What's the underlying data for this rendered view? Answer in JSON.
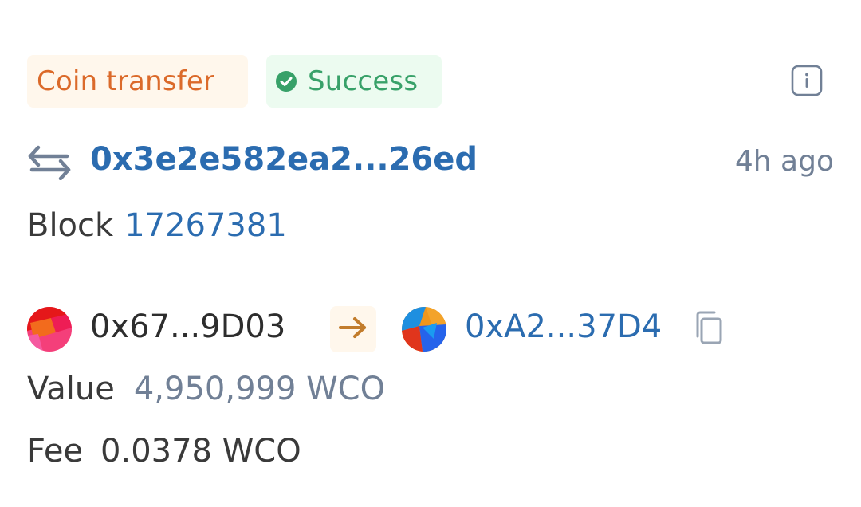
{
  "tags": {
    "type_label": "Coin transfer",
    "status_label": "Success"
  },
  "transaction": {
    "hash": "0x3e2e582ea2...26ed",
    "time_ago": "4h ago"
  },
  "block": {
    "label": "Block",
    "number": "17267381"
  },
  "addresses": {
    "from": "0x67...9D03",
    "to": "0xA2...37D4"
  },
  "value": {
    "label": "Value",
    "amount": "4,950,999 WCO"
  },
  "fee": {
    "label": "Fee",
    "amount": "0.0378 WCO"
  },
  "icons": {
    "status": "check-circle-icon",
    "info": "info-icon",
    "transfer": "swap-arrows-icon",
    "direction": "arrow-right-icon",
    "copy": "copy-icon"
  },
  "colors": {
    "type_tag_text": "#db6a2a",
    "type_tag_bg": "#fff7ec",
    "status_tag_text": "#38a169",
    "status_tag_bg": "#ecfbf0",
    "link": "#2b6cb0",
    "muted": "#718096",
    "text": "#3a3a3a",
    "arrow": "#c27c2c"
  }
}
